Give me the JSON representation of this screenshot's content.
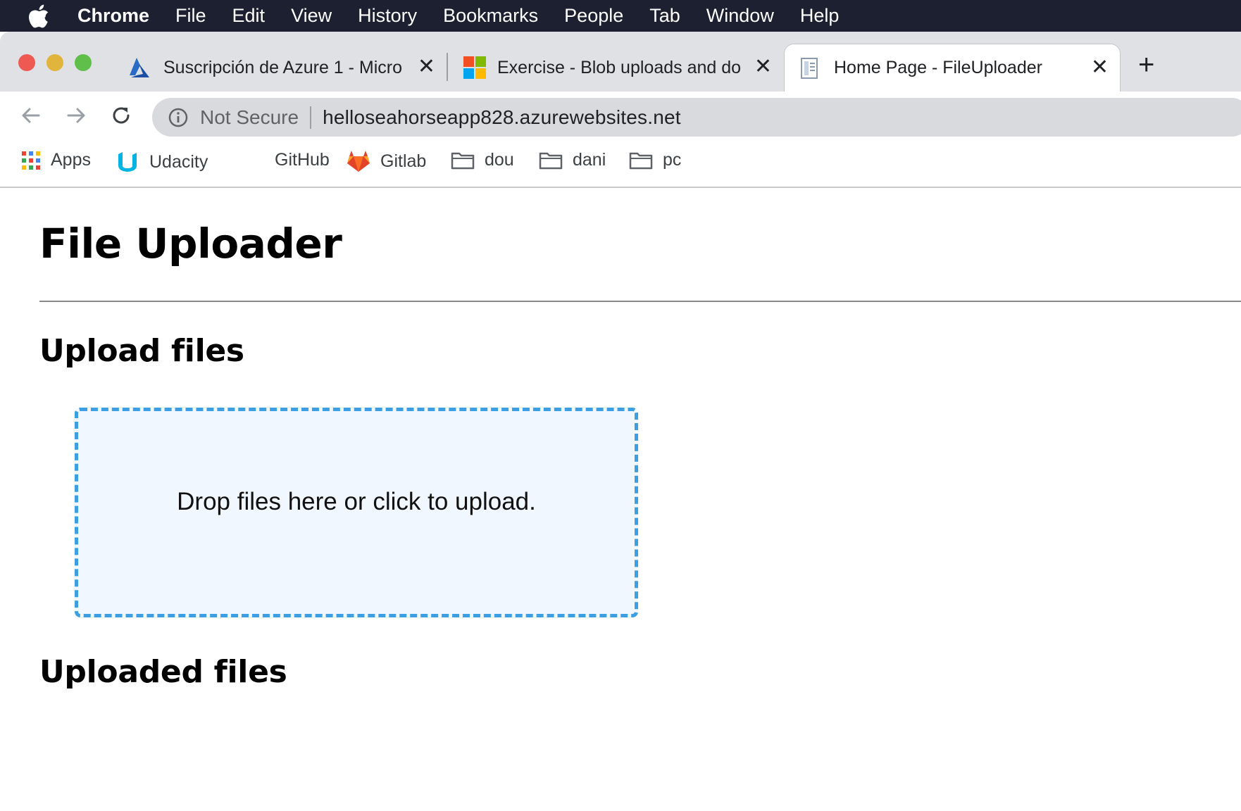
{
  "menubar": {
    "app_name": "Chrome",
    "items": [
      "File",
      "Edit",
      "View",
      "History",
      "Bookmarks",
      "People",
      "Tab",
      "Window",
      "Help"
    ]
  },
  "tabs": [
    {
      "title": "Suscripción de Azure 1 - Micro",
      "icon": "azure-icon",
      "active": false
    },
    {
      "title": "Exercise - Blob uploads and do",
      "icon": "microsoft-icon",
      "active": false
    },
    {
      "title": "Home Page - FileUploader",
      "icon": "document-icon",
      "active": true
    }
  ],
  "new_tab_label": "+",
  "close_label": "✕",
  "omnibox": {
    "security_label": "Not Secure",
    "url": "helloseahorseapp828.azurewebsites.net"
  },
  "bookmarks": [
    {
      "label": "Apps",
      "icon": "apps-grid-icon"
    },
    {
      "label": "Udacity",
      "icon": "udacity-icon"
    },
    {
      "label": "GitHub",
      "icon": "github-icon"
    },
    {
      "label": "Gitlab",
      "icon": "gitlab-icon"
    },
    {
      "label": "dou",
      "icon": "folder-icon"
    },
    {
      "label": "dani",
      "icon": "folder-icon"
    },
    {
      "label": "pc",
      "icon": "folder-icon"
    }
  ],
  "page": {
    "title": "File Uploader",
    "upload_heading": "Upload files",
    "dropzone_text": "Drop files here or click to upload.",
    "uploaded_heading": "Uploaded files"
  },
  "colors": {
    "menubar_bg": "#1c2030",
    "tabstrip_bg": "#dfe1e5",
    "dropzone_border": "#3c9fe3",
    "dropzone_bg": "#f1f7fe",
    "traffic_red": "#ee5a52",
    "traffic_yellow": "#e1b43c",
    "traffic_green": "#5fbf4a"
  }
}
